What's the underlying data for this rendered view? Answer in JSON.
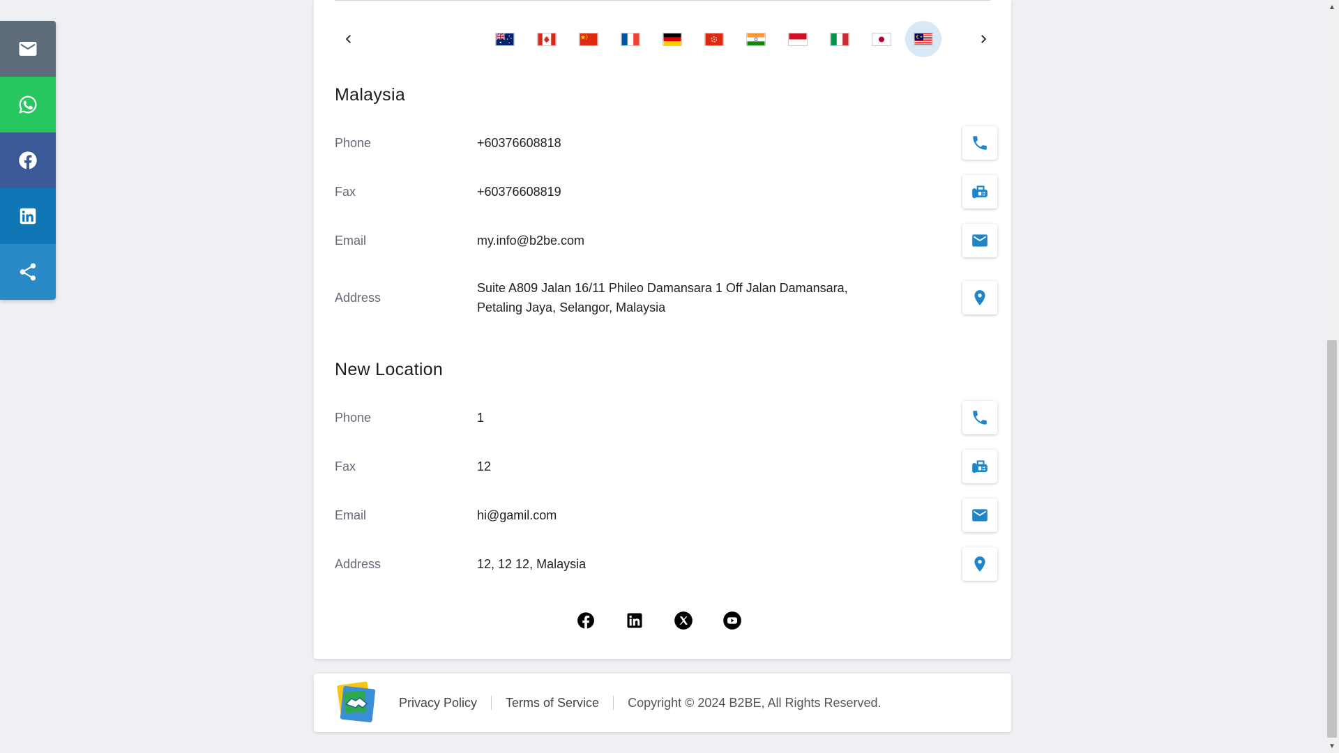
{
  "share_bar": {
    "items": [
      {
        "name": "email",
        "icon": "mail-icon",
        "color": "#5d6b7b"
      },
      {
        "name": "whatsapp",
        "icon": "whatsapp-icon",
        "color": "#27c65f"
      },
      {
        "name": "facebook",
        "icon": "facebook-icon",
        "color": "#3b5897"
      },
      {
        "name": "linkedin",
        "icon": "linkedin-icon",
        "color": "#0f75b4"
      },
      {
        "name": "share",
        "icon": "share-icon",
        "color": "#2a8ac7"
      }
    ]
  },
  "flags": [
    {
      "country": "Australia",
      "icon": "flag-australia-icon"
    },
    {
      "country": "Canada",
      "icon": "flag-canada-icon"
    },
    {
      "country": "China",
      "icon": "flag-china-icon"
    },
    {
      "country": "France",
      "icon": "flag-france-icon"
    },
    {
      "country": "Germany",
      "icon": "flag-germany-icon"
    },
    {
      "country": "Hong Kong",
      "icon": "flag-hongkong-icon"
    },
    {
      "country": "India",
      "icon": "flag-india-icon"
    },
    {
      "country": "Indonesia",
      "icon": "flag-indonesia-icon"
    },
    {
      "country": "Italy",
      "icon": "flag-italy-icon"
    },
    {
      "country": "Japan",
      "icon": "flag-japan-icon"
    },
    {
      "country": "Malaysia",
      "icon": "flag-malaysia-icon",
      "active": true
    }
  ],
  "locations": [
    {
      "title": "Malaysia",
      "phone_label": "Phone",
      "phone": "+60376608818",
      "fax_label": "Fax",
      "fax": "+60376608819",
      "email_label": "Email",
      "email": "my.info@b2be.com",
      "address_label": "Address",
      "address_line1": "Suite A809 Jalan 16/11 Phileo Damansara 1 Off Jalan Damansara,",
      "address_line2": "Petaling Jaya, Selangor, Malaysia"
    },
    {
      "title": "New Location",
      "phone_label": "Phone",
      "phone": "1",
      "fax_label": "Fax",
      "fax": "12",
      "email_label": "Email",
      "email": "hi@gamil.com",
      "address_label": "Address",
      "address_line1": "12, 12 12, Malaysia"
    }
  ],
  "socials": [
    "facebook-icon",
    "linkedin-icon",
    "x-icon",
    "youtube-icon"
  ],
  "footer": {
    "privacy": "Privacy Policy",
    "terms": "Terms of Service",
    "copyright": "Copyright © 2024 B2BE, All Rights Reserved."
  },
  "colors": {
    "accent": "#1e86c8",
    "active_flag_bg": "#d9e8f5"
  }
}
